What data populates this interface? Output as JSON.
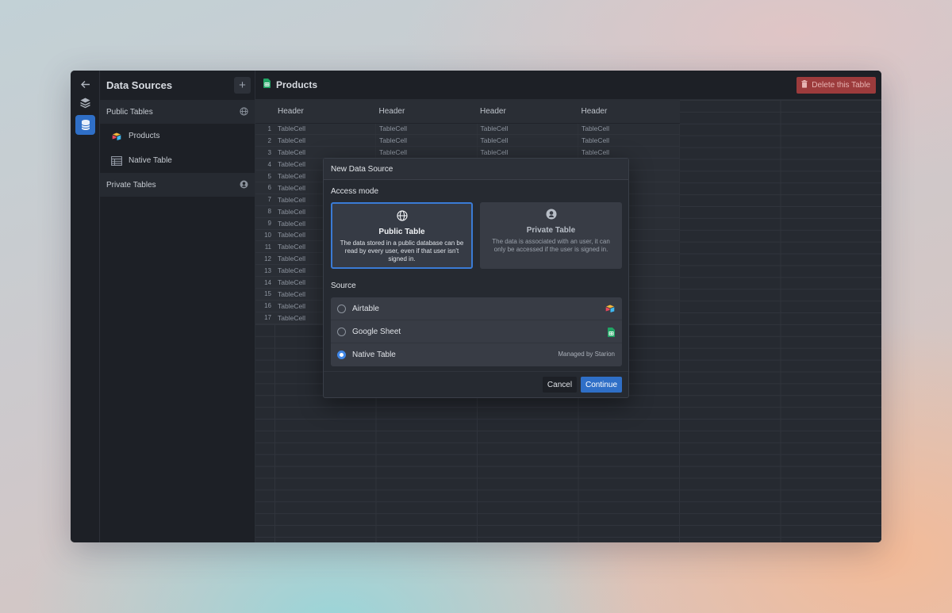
{
  "rail": {
    "icons": [
      "back-arrow-icon",
      "layers-icon",
      "database-icon"
    ]
  },
  "sidebar": {
    "title": "Data Sources",
    "add_label": "+",
    "public_section": "Public Tables",
    "items": [
      {
        "label": "Products",
        "icon": "airtable-icon"
      },
      {
        "label": "Native Table",
        "icon": "table-icon"
      }
    ],
    "private_section": "Private Tables"
  },
  "main": {
    "title": "Products",
    "delete_label": "Delete this Table"
  },
  "table": {
    "headers": [
      "Header",
      "Header",
      "Header",
      "Header"
    ],
    "rows": [
      {
        "idx": "1",
        "cells": [
          "TableCell",
          "TableCell",
          "TableCell",
          "TableCell"
        ]
      },
      {
        "idx": "2",
        "cells": [
          "TableCell",
          "TableCell",
          "TableCell",
          "TableCell"
        ]
      },
      {
        "idx": "3",
        "cells": [
          "TableCell",
          "TableCell",
          "TableCell",
          "TableCell"
        ]
      },
      {
        "idx": "4",
        "cells": [
          "TableCell",
          "",
          "",
          ""
        ]
      },
      {
        "idx": "5",
        "cells": [
          "TableCell",
          "",
          "",
          ""
        ]
      },
      {
        "idx": "6",
        "cells": [
          "TableCell",
          "",
          "",
          ""
        ]
      },
      {
        "idx": "7",
        "cells": [
          "TableCell",
          "",
          "",
          ""
        ]
      },
      {
        "idx": "8",
        "cells": [
          "TableCell",
          "",
          "",
          ""
        ]
      },
      {
        "idx": "9",
        "cells": [
          "TableCell",
          "",
          "",
          ""
        ]
      },
      {
        "idx": "10",
        "cells": [
          "TableCell",
          "",
          "",
          ""
        ]
      },
      {
        "idx": "11",
        "cells": [
          "TableCell",
          "",
          "",
          ""
        ]
      },
      {
        "idx": "12",
        "cells": [
          "TableCell",
          "",
          "",
          ""
        ]
      },
      {
        "idx": "13",
        "cells": [
          "TableCell",
          "",
          "",
          ""
        ]
      },
      {
        "idx": "14",
        "cells": [
          "TableCell",
          "",
          "",
          ""
        ]
      },
      {
        "idx": "15",
        "cells": [
          "TableCell",
          "",
          "",
          ""
        ]
      },
      {
        "idx": "16",
        "cells": [
          "TableCell",
          "",
          "",
          ""
        ]
      },
      {
        "idx": "17",
        "cells": [
          "TableCell",
          "",
          "",
          ""
        ]
      }
    ]
  },
  "modal": {
    "title": "New Data Source",
    "access_label": "Access mode",
    "public_card": {
      "title": "Public Table",
      "desc": "The data stored in a public database can be read by every user, even if that user isn't signed in."
    },
    "private_card": {
      "title": "Private Table",
      "desc": "The data is associated with an user, it can only be accessed if the user is signed in."
    },
    "source_label": "Source",
    "sources": [
      {
        "label": "Airtable",
        "right": "",
        "selected": false
      },
      {
        "label": "Google Sheet",
        "right": "",
        "selected": false
      },
      {
        "label": "Native Table",
        "right": "Managed by Starion",
        "selected": true
      }
    ],
    "cancel_label": "Cancel",
    "continue_label": "Continue"
  },
  "colors": {
    "accent": "#2f6fc7",
    "danger": "#9c3b3c",
    "window_bg": "#262a31",
    "sidebar_bg": "#1d2026"
  }
}
